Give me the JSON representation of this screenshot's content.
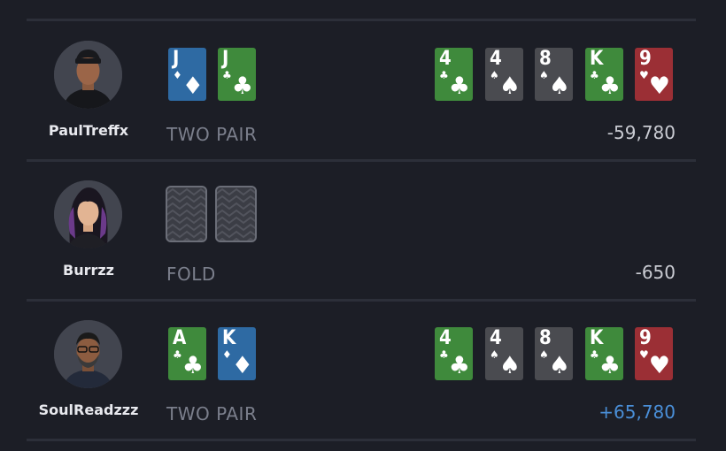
{
  "players": [
    {
      "name": "PaulTreffx",
      "hand_label": "TWO PAIR",
      "result": "-59,780",
      "hole_cards": [
        {
          "rank": "J",
          "suit": "♦",
          "color": "#2e6aa3"
        },
        {
          "rank": "J",
          "suit": "♣",
          "color": "#3f8a3c"
        }
      ]
    },
    {
      "name": "Burrzz",
      "hand_label": "FOLD",
      "result": "-650",
      "hole_cards": []
    },
    {
      "name": "SoulReadzzz",
      "hand_label": "TWO PAIR",
      "result": "+65,780",
      "hole_cards": [
        {
          "rank": "A",
          "suit": "♣",
          "color": "#3f8a3c"
        },
        {
          "rank": "K",
          "suit": "♦",
          "color": "#2e6aa3"
        }
      ]
    }
  ],
  "board": [
    {
      "rank": "4",
      "suit": "♣",
      "color": "#3f8a3c"
    },
    {
      "rank": "4",
      "suit": "♠",
      "color": "#4a4b50"
    },
    {
      "rank": "8",
      "suit": "♠",
      "color": "#4a4b50"
    },
    {
      "rank": "K",
      "suit": "♣",
      "color": "#3f8a3c"
    },
    {
      "rank": "9",
      "suit": "♥",
      "color": "#9b2f35"
    }
  ],
  "colors": {
    "win": "#4a8fd8",
    "loss": "#c9cbd2",
    "label": "#7b7f8c"
  }
}
